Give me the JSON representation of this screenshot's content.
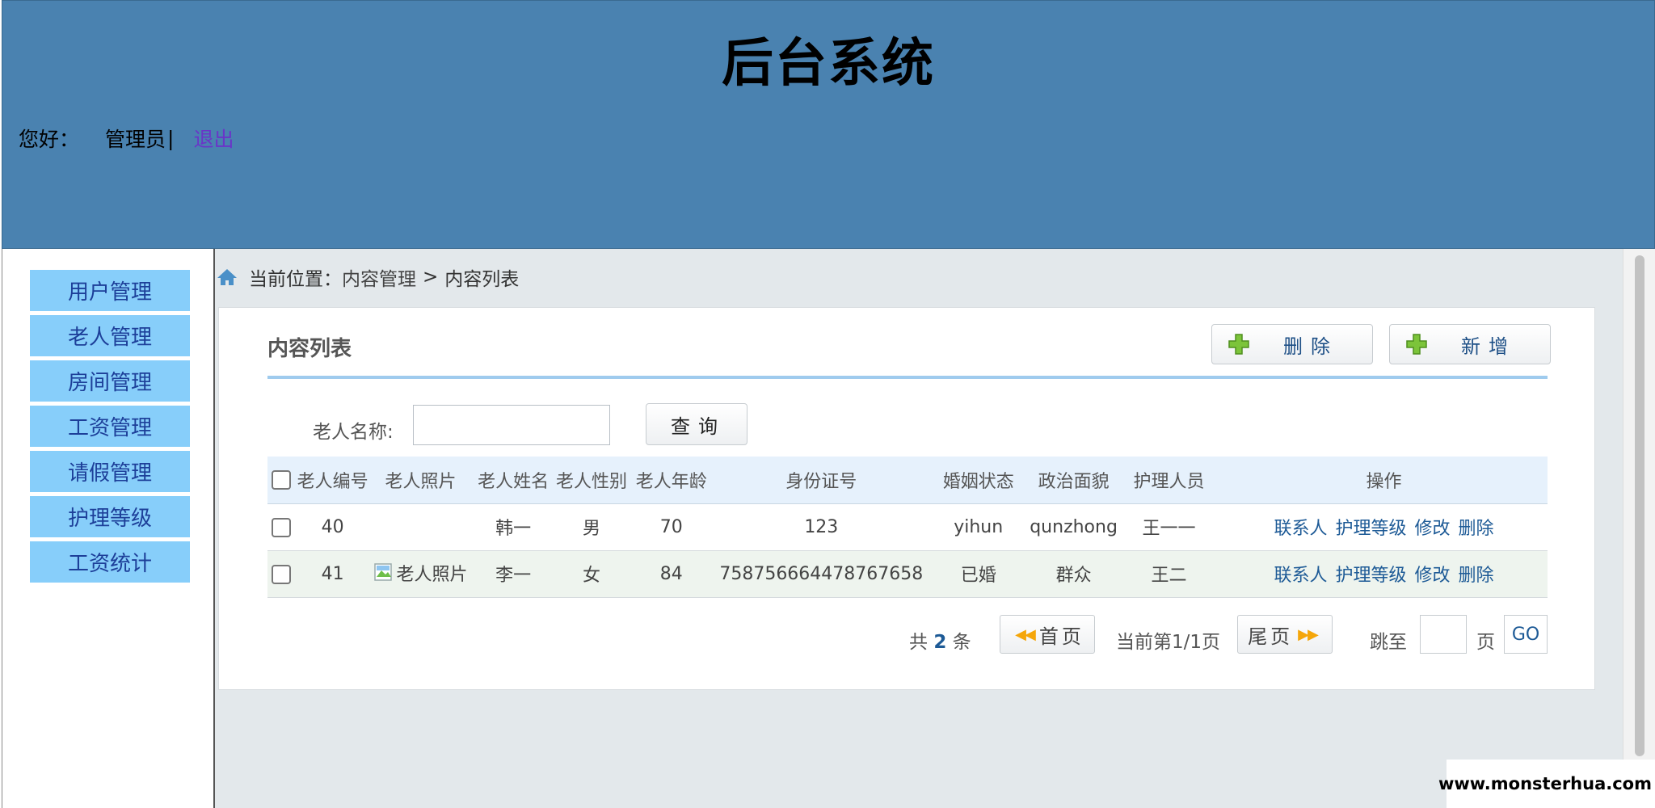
{
  "header": {
    "title": "后台系统",
    "greeting": "您好：",
    "username": "管理员",
    "separator": "|",
    "logout": "退出"
  },
  "sidebar": {
    "items": [
      {
        "label": "用户管理"
      },
      {
        "label": "老人管理"
      },
      {
        "label": "房间管理"
      },
      {
        "label": "工资管理"
      },
      {
        "label": "请假管理"
      },
      {
        "label": "护理等级"
      },
      {
        "label": "工资统计"
      }
    ]
  },
  "breadcrumb": {
    "label": "当前位置：",
    "crumb1": "内容管理",
    "arrow": ">",
    "crumb2": "内容列表"
  },
  "panel": {
    "title": "内容列表",
    "delete_label": "删除",
    "add_label": "新增"
  },
  "search": {
    "label": "老人名称:",
    "value": "",
    "button": "查询"
  },
  "table": {
    "headers": [
      "老人编号",
      "老人照片",
      "老人姓名",
      "老人性别",
      "老人年龄",
      "身份证号",
      "婚姻状态",
      "政治面貌",
      "护理人员",
      "操作"
    ],
    "rows": [
      {
        "id": "40",
        "photo": "",
        "name": "韩一",
        "gender": "男",
        "age": "70",
        "idcard": "123",
        "marital": "yihun",
        "political": "qunzhong",
        "nurse": "王一一"
      },
      {
        "id": "41",
        "photo": "老人照片",
        "name": "李一",
        "gender": "女",
        "age": "84",
        "idcard": "758756664478767658",
        "marital": "已婚",
        "political": "群众",
        "nurse": "王二"
      }
    ],
    "actions": [
      "联系人",
      "护理等级",
      "修改",
      "删除"
    ]
  },
  "pager": {
    "total_prefix": "共",
    "total": "2",
    "total_suffix": "条",
    "first": "首页",
    "current": "当前第1/1页",
    "last": "尾页",
    "jump_label": "跳至",
    "jump_value": "",
    "page_word": "页",
    "go": "GO"
  },
  "watermark": "www.monsterhua.com",
  "colors": {
    "header_bg": "#4a82b0",
    "sidebar_item_bg": "#87cefa",
    "sidebar_item_text": "#1d3f99",
    "accent_line": "#9fcbee",
    "link": "#1d5a96",
    "logout": "#6a35c8"
  },
  "icons": {
    "home": "home-icon",
    "add": "green-plus-icon",
    "first": "double-left-arrow-icon",
    "last": "double-right-arrow-icon",
    "broken_image": "broken-image-icon"
  }
}
